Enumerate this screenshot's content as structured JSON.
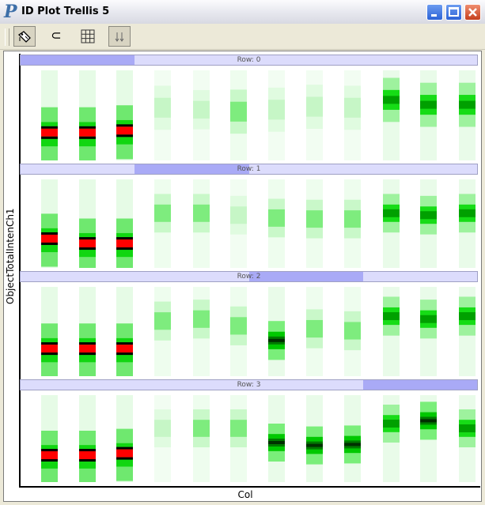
{
  "window": {
    "title": "ID Plot Trellis 5",
    "logo": "P",
    "controls": [
      "minimize-icon",
      "maximize-icon",
      "close-icon"
    ]
  },
  "toolbar": {
    "tools": [
      {
        "icon": "select-tag-icon",
        "pressed": true
      },
      {
        "icon": "subset-icon",
        "glyph": "⊂",
        "pressed": false
      },
      {
        "icon": "grid-icon",
        "pressed": false
      },
      {
        "icon": "sort-arrows-icon",
        "pressed": true
      }
    ]
  },
  "plot": {
    "y_label": "ObjectTotalIntenCh1",
    "x_label": "Col",
    "colors": {
      "low": "#e6fbe6",
      "mid": "#00dd00",
      "high": "#000000",
      "peak": "#ff0000",
      "strip": "#dcdcfc",
      "strip_highlight": "#a9aaf6"
    },
    "rows": [
      {
        "label": "Row: 0",
        "highlight": [
          0.0,
          0.25
        ],
        "cols": [
          {
            "center": 0.7,
            "spread": 0.55,
            "level": "red"
          },
          {
            "center": 0.7,
            "spread": 0.55,
            "level": "red"
          },
          {
            "center": 0.68,
            "spread": 0.55,
            "level": "red"
          },
          {
            "center": 0.43,
            "spread": 0.45,
            "level": "faint"
          },
          {
            "center": 0.45,
            "spread": 0.4,
            "level": "faint"
          },
          {
            "center": 0.47,
            "spread": 0.45,
            "level": "light"
          },
          {
            "center": 0.45,
            "spread": 0.45,
            "level": "faint"
          },
          {
            "center": 0.42,
            "spread": 0.45,
            "level": "faint"
          },
          {
            "center": 0.43,
            "spread": 0.45,
            "level": "faint"
          },
          {
            "center": 0.35,
            "spread": 0.45,
            "level": "medium"
          },
          {
            "center": 0.4,
            "spread": 0.45,
            "level": "medium"
          },
          {
            "center": 0.4,
            "spread": 0.45,
            "level": "medium"
          }
        ]
      },
      {
        "label": "Row: 1",
        "highlight": [
          0.25,
          0.5
        ],
        "cols": [
          {
            "center": 0.68,
            "spread": 0.55,
            "level": "red"
          },
          {
            "center": 0.73,
            "spread": 0.55,
            "level": "red"
          },
          {
            "center": 0.73,
            "spread": 0.55,
            "level": "red"
          },
          {
            "center": 0.4,
            "spread": 0.4,
            "level": "light"
          },
          {
            "center": 0.4,
            "spread": 0.4,
            "level": "light"
          },
          {
            "center": 0.42,
            "spread": 0.4,
            "level": "faint"
          },
          {
            "center": 0.45,
            "spread": 0.4,
            "level": "light"
          },
          {
            "center": 0.46,
            "spread": 0.4,
            "level": "light"
          },
          {
            "center": 0.46,
            "spread": 0.4,
            "level": "light"
          },
          {
            "center": 0.4,
            "spread": 0.4,
            "level": "medium"
          },
          {
            "center": 0.42,
            "spread": 0.4,
            "level": "medium"
          },
          {
            "center": 0.4,
            "spread": 0.4,
            "level": "medium"
          }
        ]
      },
      {
        "label": "Row: 2",
        "highlight": [
          0.5,
          0.75
        ],
        "cols": [
          {
            "center": 0.7,
            "spread": 0.55,
            "level": "red"
          },
          {
            "center": 0.7,
            "spread": 0.55,
            "level": "red"
          },
          {
            "center": 0.7,
            "spread": 0.55,
            "level": "red"
          },
          {
            "center": 0.4,
            "spread": 0.4,
            "level": "light"
          },
          {
            "center": 0.38,
            "spread": 0.4,
            "level": "light"
          },
          {
            "center": 0.45,
            "spread": 0.4,
            "level": "light"
          },
          {
            "center": 0.6,
            "spread": 0.4,
            "level": "dark"
          },
          {
            "center": 0.48,
            "spread": 0.4,
            "level": "light"
          },
          {
            "center": 0.5,
            "spread": 0.4,
            "level": "light"
          },
          {
            "center": 0.35,
            "spread": 0.4,
            "level": "medium"
          },
          {
            "center": 0.38,
            "spread": 0.4,
            "level": "medium"
          },
          {
            "center": 0.35,
            "spread": 0.4,
            "level": "medium"
          }
        ]
      },
      {
        "label": "Row: 3",
        "highlight": [
          0.75,
          1.0
        ],
        "cols": [
          {
            "center": 0.7,
            "spread": 0.55,
            "level": "red"
          },
          {
            "center": 0.7,
            "spread": 0.55,
            "level": "red"
          },
          {
            "center": 0.68,
            "spread": 0.55,
            "level": "red"
          },
          {
            "center": 0.4,
            "spread": 0.4,
            "level": "faint"
          },
          {
            "center": 0.4,
            "spread": 0.4,
            "level": "light"
          },
          {
            "center": 0.4,
            "spread": 0.4,
            "level": "light"
          },
          {
            "center": 0.55,
            "spread": 0.4,
            "level": "dark"
          },
          {
            "center": 0.58,
            "spread": 0.4,
            "level": "dark"
          },
          {
            "center": 0.57,
            "spread": 0.4,
            "level": "dark"
          },
          {
            "center": 0.35,
            "spread": 0.4,
            "level": "medium"
          },
          {
            "center": 0.32,
            "spread": 0.4,
            "level": "dark"
          },
          {
            "center": 0.4,
            "spread": 0.4,
            "level": "medium"
          }
        ]
      }
    ]
  }
}
